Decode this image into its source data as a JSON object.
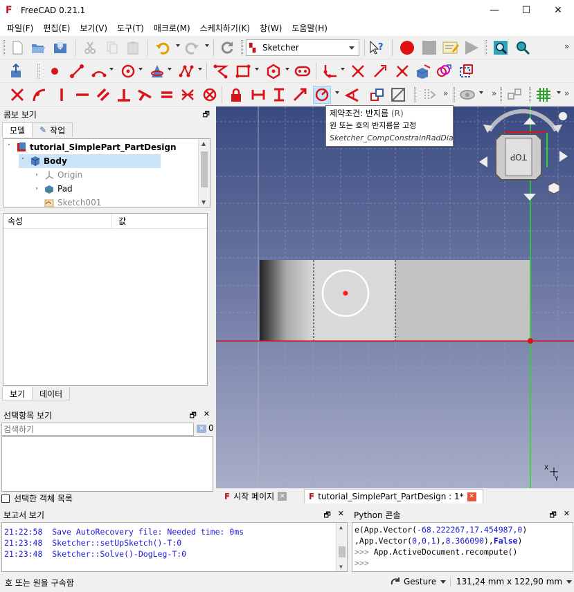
{
  "window": {
    "title": "FreeCAD 0.21.1",
    "minimize": "—",
    "maximize": "☐",
    "close": "✕"
  },
  "menu": [
    "파일(F)",
    "편집(E)",
    "보기(V)",
    "도구(T)",
    "매크로(M)",
    "스케치하기(K)",
    "창(W)",
    "도움말(H)"
  ],
  "toolbar": {
    "workbench": "Sketcher"
  },
  "combo": {
    "title": "콤보 보기",
    "tabs": [
      "모델",
      "작업"
    ],
    "tree": [
      {
        "label": "tutorial_SimplePart_PartDesign",
        "expanded": true
      },
      {
        "label": "Body",
        "expanded": true
      },
      {
        "label": "Origin"
      },
      {
        "label": "Pad"
      },
      {
        "label": "Sketch001"
      }
    ],
    "props_cols": [
      "속성",
      "값"
    ],
    "bottom_tabs": [
      "보기",
      "데이터"
    ]
  },
  "selection": {
    "title": "선택항목 보기",
    "search_placeholder": "검색하기",
    "count": "0",
    "checkbox_label": "선택한 객체 목록"
  },
  "tooltip": {
    "title": "제약조건: 반지름",
    "shortcut": "(R)",
    "desc": "원 또는 호의 반지름을 고정",
    "command": "Sketcher_CompConstrainRadDia"
  },
  "navcube": {
    "face": "TOP"
  },
  "axis": {
    "x": "X",
    "y": "Y"
  },
  "doc_tabs": [
    {
      "label": "시작 페이지",
      "active": false
    },
    {
      "label": "tutorial_SimplePart_PartDesign : 1*",
      "active": true
    }
  ],
  "report": {
    "title": "보고서 보기",
    "lines": [
      "21:22:58  Save AutoRecovery file: Needed time: 0ms",
      "21:23:48  Sketcher::setUpSketch()-T:0",
      "21:23:48  Sketcher::Solve()-DogLeg-T:0"
    ]
  },
  "python": {
    "title": "Python 콘솔",
    "line1_a": "e(App.Vector(",
    "line1_b": "-68.222267,17.454987,0",
    "line1_c": ")",
    "line2_a": ",App.Vector(",
    "line2_b": "0,0,1",
    "line2_c": "),",
    "line2_d": "8.366090",
    "line2_e": "),",
    "line2_f": "False",
    "line2_g": ")",
    "line3_prompt": ">>> ",
    "line3": "App.ActiveDocument.recompute()",
    "line4_prompt": ">>>"
  },
  "status": {
    "message": "호 또는 원을 구속함",
    "nav_style": "Gesture",
    "dimensions": "131,24 mm x 122,90 mm"
  },
  "colors": {
    "sketch_red": "#d8141b",
    "axis_green": "#22dd22",
    "accent": "#c0141b"
  }
}
